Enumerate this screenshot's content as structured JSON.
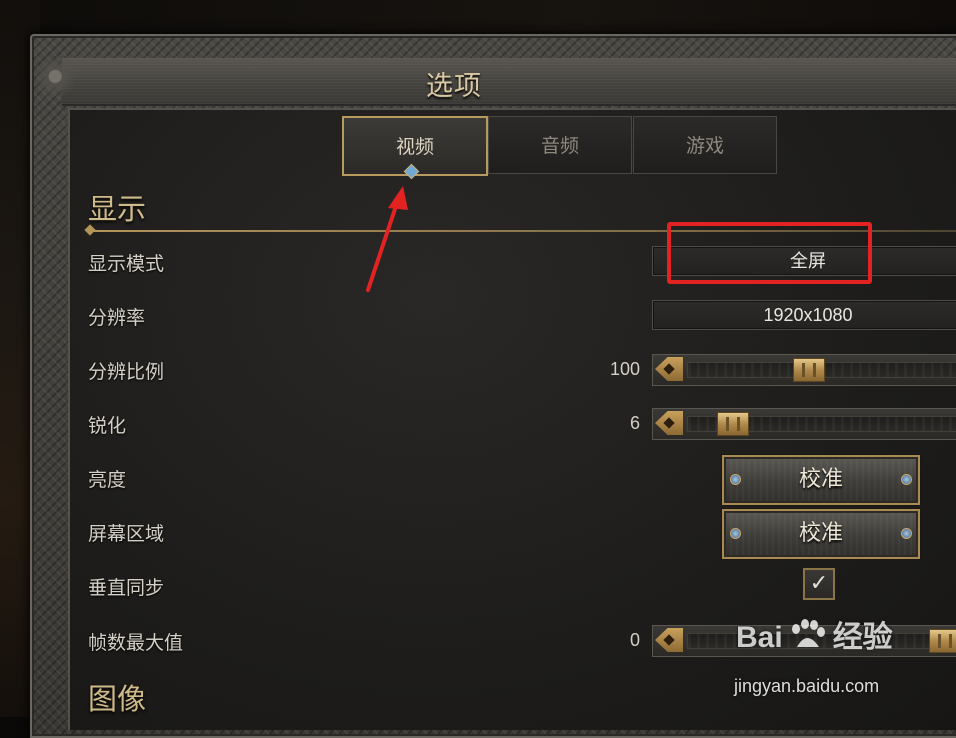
{
  "window": {
    "title": "选项"
  },
  "tabs": [
    {
      "label": "视频",
      "active": true
    },
    {
      "label": "音频",
      "active": false
    },
    {
      "label": "游戏",
      "active": false
    }
  ],
  "sections": {
    "display": "显示",
    "image": "图像"
  },
  "settings": {
    "display_mode": {
      "label": "显示模式",
      "value": "全屏"
    },
    "resolution": {
      "label": "分辨率",
      "value": "1920x1080"
    },
    "resolution_scale": {
      "label": "分辨比例",
      "value": "100",
      "slider_fraction": 0.4
    },
    "sharpening": {
      "label": "锐化",
      "value": "6",
      "slider_fraction": 0.06
    },
    "brightness": {
      "label": "亮度",
      "button": "校准"
    },
    "screen_area": {
      "label": "屏幕区域",
      "button": "校准"
    },
    "vsync": {
      "label": "垂直同步",
      "checked": true,
      "check_glyph": "✓"
    },
    "max_fps": {
      "label": "帧数最大值",
      "value": "0",
      "slider_fraction": 1.0
    }
  },
  "annotations": {
    "highlight_color": "#e32222",
    "arrow_color": "#e32222"
  },
  "watermark": {
    "brand_left": "Bai",
    "brand_right": "经验",
    "url": "jingyan.baidu.com"
  }
}
